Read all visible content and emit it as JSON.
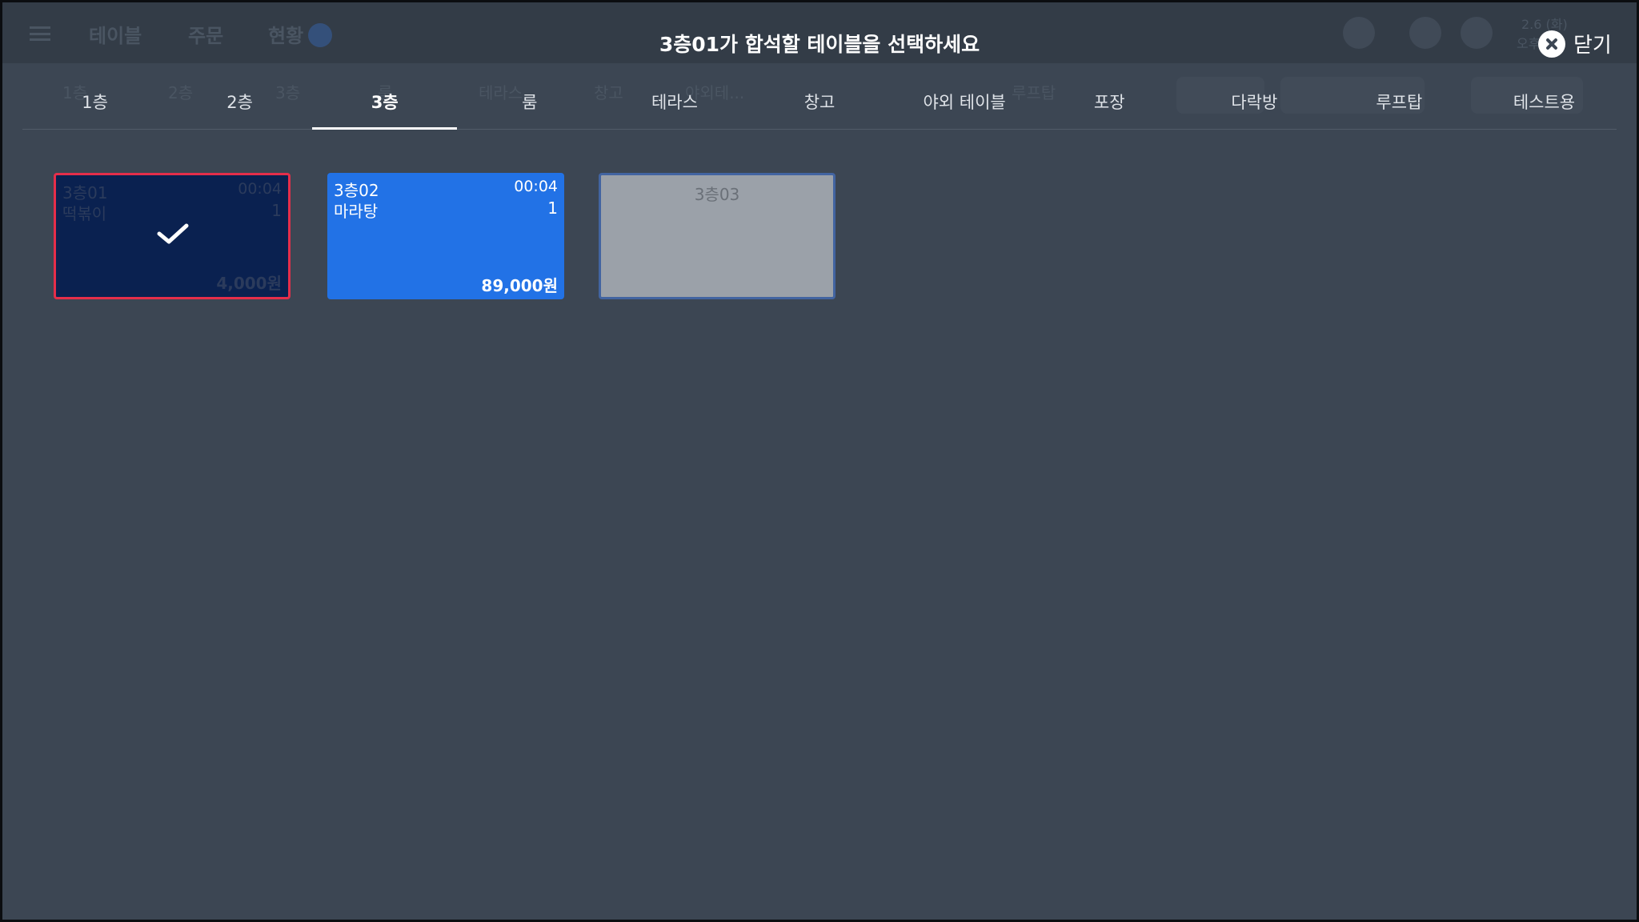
{
  "background_app": {
    "header_tabs": [
      "테이블",
      "주문",
      "현황"
    ],
    "status_text": [
      "2.6 (화)",
      "오후"
    ],
    "floor_tabs": [
      "1층",
      "2층",
      "3층",
      "테라스",
      "룸",
      "창고",
      "야외테...",
      "루프탑"
    ]
  },
  "modal": {
    "title": "3층01가 합석할 테이블을 선택하세요",
    "close_label": "닫기"
  },
  "tabs": [
    {
      "label": "1층"
    },
    {
      "label": "2층"
    },
    {
      "label": "3층"
    },
    {
      "label": "룸"
    },
    {
      "label": "테라스"
    },
    {
      "label": "창고"
    },
    {
      "label": "야외 테이블"
    },
    {
      "label": "포장"
    },
    {
      "label": "다락방"
    },
    {
      "label": "루프탑"
    },
    {
      "label": "테스트용"
    }
  ],
  "active_tab": "3층",
  "tables": [
    {
      "name": "3층01",
      "time": "00:04",
      "menu": "떡볶이",
      "count": "1",
      "price": "4,000원",
      "state": "selected"
    },
    {
      "name": "3층02",
      "time": "00:04",
      "menu": "마라탕",
      "count": "1",
      "price": "89,000원",
      "state": "occupied"
    },
    {
      "name": "3층03",
      "state": "empty"
    }
  ],
  "colors": {
    "background": "#3c4653",
    "selected_card": "#0a2150",
    "selected_border": "#e52e4a",
    "occupied_card": "#2272e6",
    "empty_card": "#9ba1a9"
  }
}
